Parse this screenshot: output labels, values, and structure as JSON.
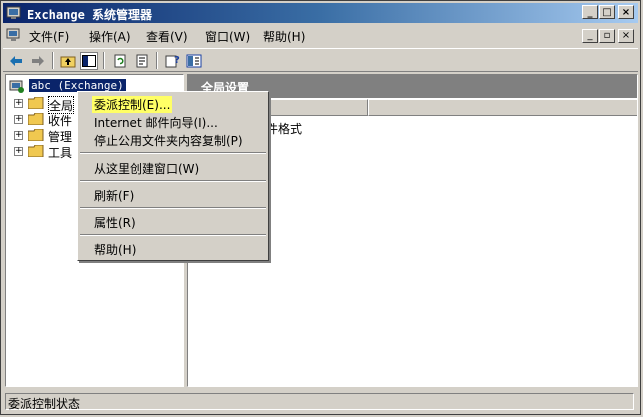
{
  "window": {
    "title": "Exchange 系统管理器",
    "controls": {
      "minimize": "_",
      "maximize": "□",
      "close": "×"
    }
  },
  "menubar": {
    "items": [
      "文件(F)",
      "操作(A)",
      "查看(V)",
      "窗口(W)",
      "帮助(H)"
    ],
    "mdi_controls": {
      "minimize": "_",
      "restore": "▫",
      "close": "×"
    }
  },
  "toolbar": {
    "icons": [
      "back-arrow-icon",
      "forward-arrow-icon",
      "up-folder-icon",
      "show-tree-icon",
      "refresh-icon",
      "export-list-icon",
      "properties-help-icon",
      "mmc-snapin-icon"
    ]
  },
  "tree": {
    "root": "abc (Exchange)",
    "children": [
      "全局",
      "收件",
      "管理",
      "工具"
    ]
  },
  "right_pane": {
    "header": "全局设置",
    "visible_text": "邮件格式"
  },
  "context_menu": {
    "items": [
      {
        "label": "委派控制(E)...",
        "highlighted": true
      },
      {
        "label": "Internet 邮件向导(I)..."
      },
      {
        "label": "停止公用文件夹内容复制(P)"
      },
      {
        "label": "从这里创建窗口(W)"
      },
      {
        "label": "刷新(F)"
      },
      {
        "label": "属性(R)"
      },
      {
        "label": "帮助(H)"
      }
    ],
    "highlight_color": "#ffff66"
  },
  "statusbar": {
    "text": "委派控制状态"
  }
}
